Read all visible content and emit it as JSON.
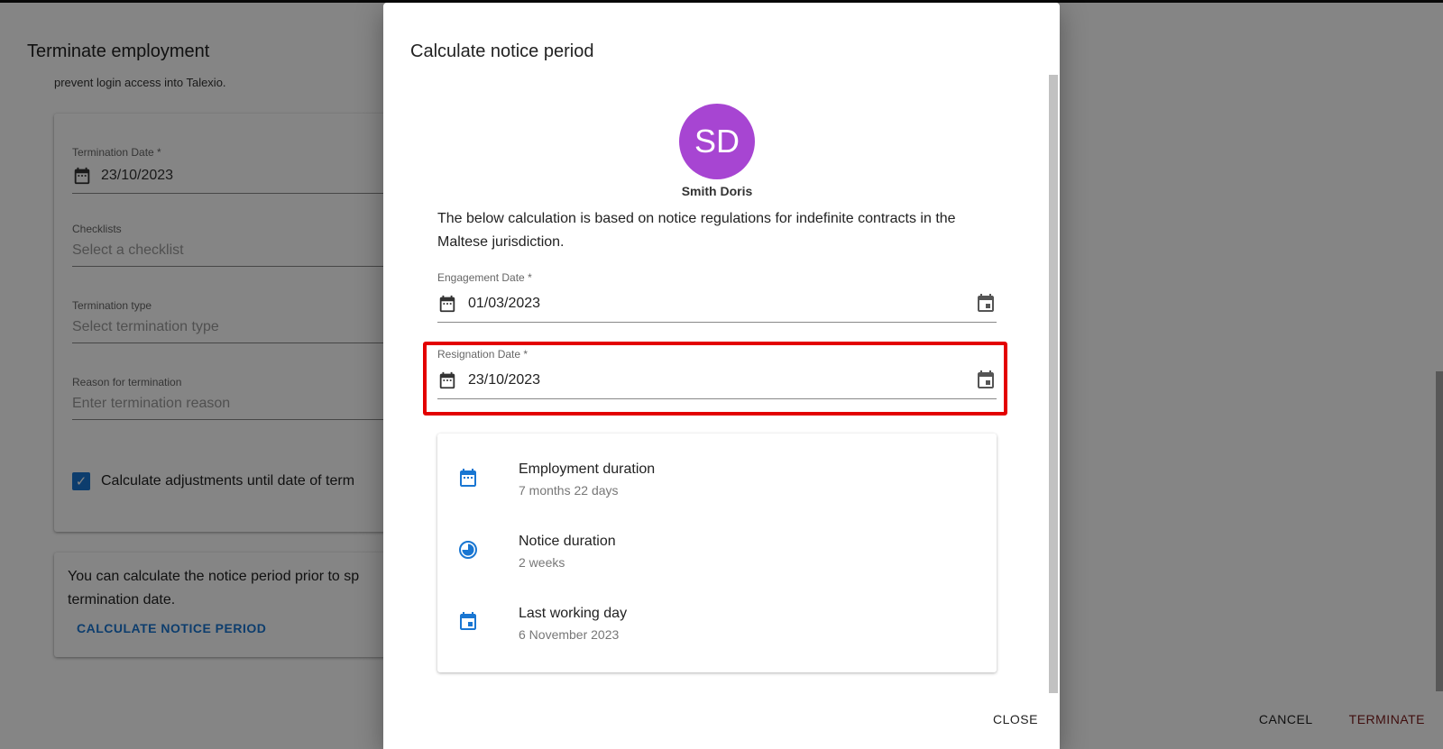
{
  "background": {
    "page_title": "Terminate employment",
    "subtitle": "prevent login access into Talexio.",
    "fields": [
      {
        "label": "Termination Date *",
        "value": "23/10/2023"
      },
      {
        "label": "Checklists",
        "placeholder": "Select a checklist"
      },
      {
        "label": "Termination type",
        "placeholder": "Select termination type"
      },
      {
        "label": "Reason for termination",
        "placeholder": "Enter termination reason"
      }
    ],
    "checkbox_label": "Calculate adjustments until date of term",
    "notice_text": "You can calculate the notice period prior to sp termination date.",
    "calculate_link": "CALCULATE NOTICE PERIOD",
    "cancel_label": "CANCEL",
    "terminate_label": "TERMINATE"
  },
  "dialog": {
    "title": "Calculate notice period",
    "avatar_initials": "SD",
    "employee_name": "Smith Doris",
    "description": "The below calculation is based on notice regulations for indefinite contracts in the Maltese jurisdiction.",
    "engagement_date": {
      "label": "Engagement Date *",
      "value": "01/03/2023"
    },
    "resignation_date": {
      "label": "Resignation Date *",
      "value": "23/10/2023"
    },
    "summary": [
      {
        "title": "Employment duration",
        "value": "7 months 22 days",
        "icon": "calendar-icon"
      },
      {
        "title": "Notice duration",
        "value": "2 weeks",
        "icon": "clock-icon"
      },
      {
        "title": "Last working day",
        "value": "6 November 2023",
        "icon": "event-icon"
      }
    ],
    "close_label": "CLOSE"
  },
  "colors": {
    "accent": "#1976d2",
    "avatar": "#a745d2",
    "highlight": "#e30000",
    "terminate": "#7a1a1a"
  }
}
